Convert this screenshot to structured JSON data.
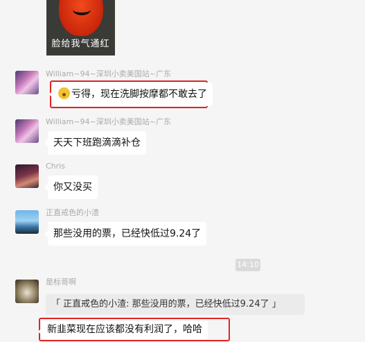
{
  "sticker": {
    "caption": "脸给我气通红"
  },
  "time_divider": "14:10",
  "messages": [
    {
      "sender": "William~94~深圳小卖美国站~广东",
      "text": "亏得，现在洗脚按摩都不敢去了",
      "has_emoji": true,
      "highlighted": true
    },
    {
      "sender": "William~94~深圳小卖美国站~广东",
      "text": "天天下班跑滴滴补仓"
    },
    {
      "sender": "Chris",
      "text": "你又没买"
    },
    {
      "sender": "正直戒色的小渣",
      "text": "那些没用的票，已经快低过9.24了"
    },
    {
      "sender": "是标哥啊",
      "quote": "「 正直戒色的小渣: 那些没用的票，已经快低过9.24了 」",
      "text": "新韭菜现在应该都没有利润了，哈哈",
      "highlighted": true
    }
  ],
  "colors": {
    "highlight_border": "#e02424",
    "bubble": "#ffffff",
    "background": "#f5f5f5"
  }
}
